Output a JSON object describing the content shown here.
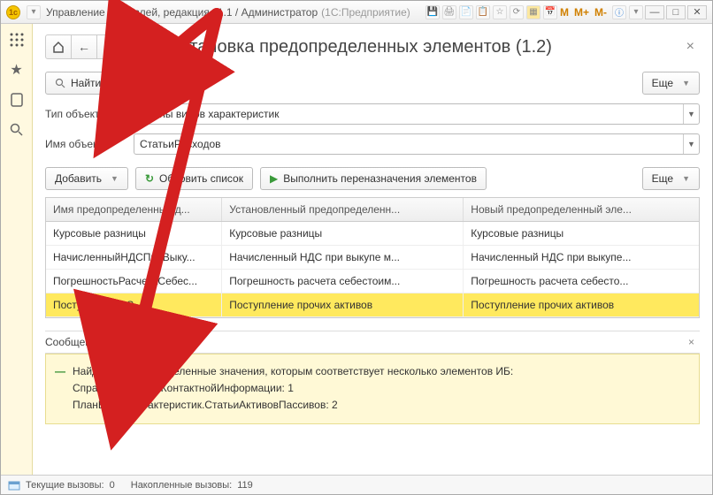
{
  "titlebar": {
    "title": "Управление торговлей, редакция 11.1 / Администратор",
    "context": "(1С:Предприятие)",
    "m_buttons": [
      "M",
      "M+",
      "M-"
    ]
  },
  "leftbar": {
    "items": [
      "grid-icon",
      "star-icon",
      "clipboard-icon",
      "search-icon"
    ]
  },
  "page": {
    "title": "Установка предопределенных элементов (1.2)"
  },
  "find_duplicates_btn": "Найти дубли",
  "more_btn": "Еще",
  "fields": {
    "type_label": "Тип объекта:",
    "type_value": "Планы видов характеристик",
    "name_label": "Имя объекта:",
    "name_value": "СтатьиРасходов"
  },
  "toolbar": {
    "add": "Добавить",
    "refresh": "Обновить список",
    "run": "Выполнить переназначения элементов",
    "more": "Еще"
  },
  "table": {
    "headers": [
      "Имя предопределенных д...",
      "Установленный предопределенн...",
      "Новый предопределенный эле..."
    ],
    "rows": [
      [
        "Курсовые разницы",
        "Курсовые разницы",
        "Курсовые разницы"
      ],
      [
        "НачисленныйНДСПриВыку...",
        "Начисленный НДС при выкупе м...",
        "Начисленный НДС при выкупе..."
      ],
      [
        "ПогрешностьРасчетаСебес...",
        "Погрешность расчета себестоим...",
        "Погрешность расчета себесто..."
      ],
      [
        "ПоступлениеОС",
        "Поступление прочих активов",
        "Поступление прочих активов"
      ]
    ],
    "selected_row": 3
  },
  "messages": {
    "header": "Сообщения:",
    "lines": [
      "Найдены предопределенные значения, которым соответствует несколько элементов ИБ:",
      "Справочник.ВидыКонтактнойИнформации: 1",
      "ПланВидовХарактеристик.СтатьиАктивовПассивов: 2"
    ]
  },
  "statusbar": {
    "current_label": "Текущие вызовы:",
    "current_value": "0",
    "accum_label": "Накопленные вызовы:",
    "accum_value": "119"
  }
}
